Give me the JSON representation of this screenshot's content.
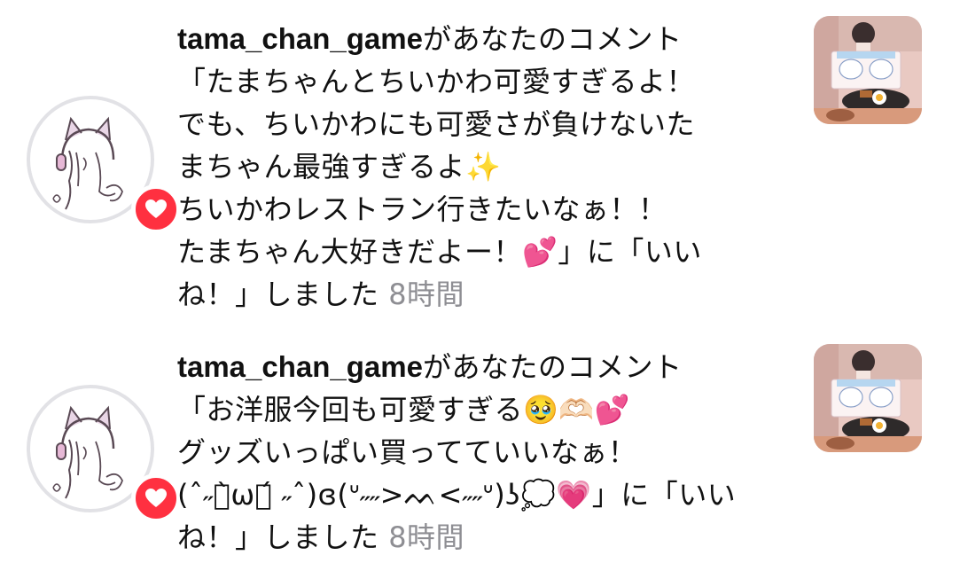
{
  "colors": {
    "heart_badge": "#ff3040",
    "time_text": "#8e8e93",
    "avatar_ring": "#e2e2e6"
  },
  "notifications": [
    {
      "username": "tama_chan_game",
      "lines": [
        "があなたのコメント",
        "「たまちゃんとちいかわ可愛すぎるよ！",
        "でも、ちいかわにも可愛さが負けないた",
        "まちゃん最強すぎるよ✨",
        "ちいかわレストラン行きたいなぁ！！",
        "たまちゃん大好きだよー！💕」に「いい",
        "ね！」しました"
      ],
      "time": "8時間",
      "avatar_icon": "cat-ear-headphone-girl-icon",
      "badge_icon": "heart-icon",
      "thumbnail_icon": "post-thumbnail"
    },
    {
      "username": "tama_chan_game",
      "lines": [
        "があなたのコメント",
        "「お洋服今回も可愛すぎる🥹🫶🏻💕",
        "グッズいっぱい買ってていいなぁ！",
        "(ˆ˶ฅ̀ωฅ́ ˶ˆ)ɞ(ᐡ˶˶>ᨓ<˶˶ᐡ)ʖ💭💗」に「いい",
        "ね！」しました"
      ],
      "time": "8時間",
      "avatar_icon": "cat-ear-headphone-girl-icon",
      "badge_icon": "heart-icon",
      "thumbnail_icon": "post-thumbnail"
    }
  ]
}
